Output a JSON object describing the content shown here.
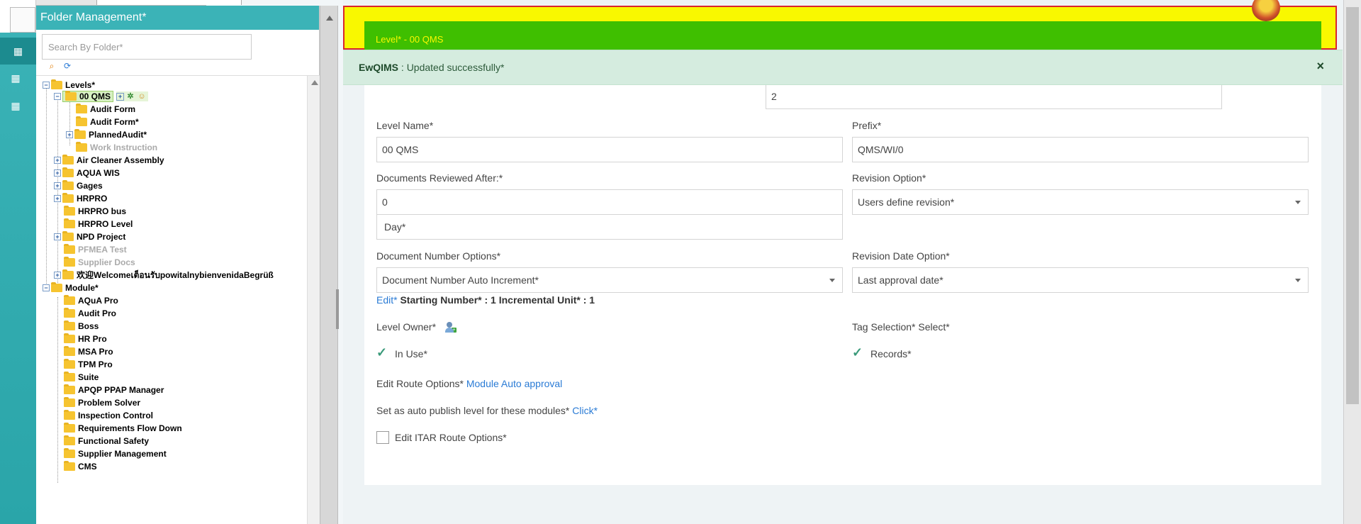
{
  "sidebar": {
    "icons": [
      "building-icon",
      "building-icon",
      "building-icon"
    ]
  },
  "panel": {
    "title": "Folder Management*",
    "search_placeholder": "Search By Folder*",
    "more_actions": "more actions",
    "tree": {
      "levels_root": "Levels*",
      "levels": [
        {
          "label": "00 QMS",
          "expanded": true
        },
        {
          "label": "Audit Form"
        },
        {
          "label": "Audit Form*"
        },
        {
          "label": "PlannedAudit*"
        },
        {
          "label": "Work Instruction",
          "muted": true
        },
        {
          "label": "Air Cleaner Assembly"
        },
        {
          "label": "AQUA WIS"
        },
        {
          "label": "Gages"
        },
        {
          "label": "HRPRO"
        },
        {
          "label": "HRPRO bus"
        },
        {
          "label": "HRPRO Level"
        },
        {
          "label": "NPD Project"
        },
        {
          "label": "PFMEA Test",
          "muted": true
        },
        {
          "label": "Supplier Docs",
          "muted": true
        },
        {
          "label": "欢迎Welcomeเต็อนรับpowitalnybienvenidaBegrüß"
        }
      ],
      "module_root": "Module*",
      "modules": [
        "AQuA Pro",
        "Audit Pro",
        "Boss",
        "HR Pro",
        "MSA Pro",
        "TPM Pro",
        "Suite",
        "APQP PPAP Manager",
        "Problem Solver",
        "Inspection Control",
        "Requirements Flow Down",
        "Functional Safety",
        "Supplier Management",
        "CMS"
      ]
    }
  },
  "main": {
    "banner": "Level* - 00 QMS",
    "toast": {
      "app": "EwQIMS",
      "sep": " : ",
      "message": "Updated successfully*",
      "close": "×"
    },
    "top_right_value": "2",
    "level_name": {
      "label": "Level Name*",
      "value": "00 QMS"
    },
    "prefix": {
      "label": "Prefix*",
      "value": "QMS/WI/0"
    },
    "reviewed_after": {
      "label": "Documents Reviewed After:*",
      "value": "0",
      "unit": "Day*"
    },
    "revision_option": {
      "label": "Revision Option*",
      "value": "Users define revision*"
    },
    "doc_number_options": {
      "label": "Document Number Options*",
      "value": "Document Number Auto Increment*"
    },
    "revision_date_option": {
      "label": "Revision Date Option*",
      "value": "Last approval date*"
    },
    "edit_link": "Edit*",
    "starting_number": "Starting Number* : 1 Incremental Unit* : 1",
    "level_owner": "Level Owner*",
    "tag_selection": "Tag Selection* Select*",
    "in_use": "In Use*",
    "records": "Records*",
    "edit_route_label": "Edit Route Options*",
    "edit_route_link": "Module Auto approval",
    "auto_publish_label": "Set as auto publish level for these modules*",
    "auto_publish_link": "Click*",
    "itar_label": "Edit ITAR Route Options*"
  }
}
